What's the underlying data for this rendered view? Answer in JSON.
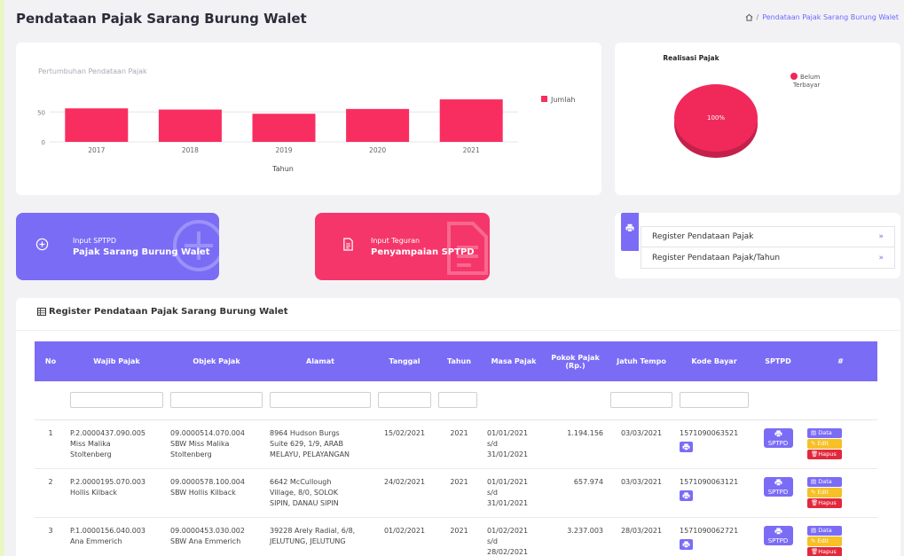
{
  "page": {
    "title": "Pendataan Pajak Sarang Burung Walet",
    "breadcrumb": [
      "Pendataan Pajak Sarang Burung Walet"
    ]
  },
  "bar_chart_card": {
    "chart_data": {
      "type": "bar",
      "title": "Pertumbuhan Pendataan Pajak",
      "xlabel": "Tahun",
      "categories": [
        "2017",
        "2018",
        "2019",
        "2020",
        "2021"
      ],
      "series": [
        {
          "name": "Jumlah",
          "values": [
            56,
            54,
            47,
            55,
            71
          ]
        }
      ],
      "yticks": [
        "50",
        "0"
      ],
      "ylim": [
        0,
        80
      ],
      "grid": true,
      "legend": "right",
      "color": "#f92e60"
    }
  },
  "pie_card": {
    "chart_data": {
      "type": "pie",
      "title": "Realisasi Pajak",
      "slices": [
        {
          "name": "Belum Terbayar",
          "value": 100,
          "label": "100%"
        }
      ],
      "legend": "top-right",
      "color": "#f0295a"
    },
    "legend_line1": "Belum",
    "legend_line2": "Terbayar"
  },
  "actions": {
    "sptpd": {
      "line1": "Input SPTPD",
      "line2": "Pajak Sarang Burung Walet",
      "color": "#7b6cf6"
    },
    "teguran": {
      "line1": "Input Teguran",
      "line2": "Penyampaian SPTPD",
      "color": "#f5366a"
    }
  },
  "register_links": {
    "items": [
      {
        "label": "Register Pendataan Pajak",
        "chevron": "»"
      },
      {
        "label": "Register Pendataan Pajak/Tahun",
        "chevron": "»"
      }
    ]
  },
  "table": {
    "title": "Register Pendataan Pajak Sarang Burung Walet",
    "headers": [
      "No",
      "Wajib Pajak",
      "Objek Pajak",
      "Alamat",
      "Tanggal",
      "Tahun",
      "Masa Pajak",
      "Pokok Pajak (Rp.)",
      "Jatuh Tempo",
      "Kode Bayar",
      "SPTPD",
      "#"
    ],
    "rows": [
      {
        "no": "1",
        "wajib_pajak": [
          "P.2.0000437.090.005",
          "Miss Malika",
          "Stoltenberg"
        ],
        "objek_pajak": [
          "09.0000514.070.004",
          "SBW Miss Malika",
          "Stoltenberg"
        ],
        "alamat": [
          "8964 Hudson Burgs",
          "Suite 629, 1/9, ARAB",
          "MELAYU, PELAYANGAN"
        ],
        "tanggal": "15/02/2021",
        "tahun": "2021",
        "masa_pajak": [
          "01/01/2021",
          "s/d",
          "31/01/2021"
        ],
        "pokok": "1.194.156",
        "jatuh_tempo": "03/03/2021",
        "kode_bayar": "1571090063521"
      },
      {
        "no": "2",
        "wajib_pajak": [
          "P.2.0000195.070.003",
          "Hollis Kilback"
        ],
        "objek_pajak": [
          "09.0000578.100.004",
          "SBW Hollis Kilback"
        ],
        "alamat": [
          "6642 McCullough",
          "Village, 8/0, SOLOK",
          "SIPIN, DANAU SIPIN"
        ],
        "tanggal": "24/02/2021",
        "tahun": "2021",
        "masa_pajak": [
          "01/01/2021",
          "s/d",
          "31/01/2021"
        ],
        "pokok": "657.974",
        "jatuh_tempo": "03/03/2021",
        "kode_bayar": "1571090063121"
      },
      {
        "no": "3",
        "wajib_pajak": [
          "P.1.0000156.040.003",
          "Ana Emmerich"
        ],
        "objek_pajak": [
          "09.0000453.030.002",
          "SBW Ana Emmerich"
        ],
        "alamat": [
          "39228 Arely Radial, 6/8,",
          "JELUTUNG, JELUTUNG"
        ],
        "tanggal": "01/02/2021",
        "tahun": "2021",
        "masa_pajak": [
          "01/02/2021",
          "s/d",
          "28/02/2021"
        ],
        "pokok": "3.237.003",
        "jatuh_tempo": "28/03/2021",
        "kode_bayar": "1571090062721"
      }
    ],
    "buttons": {
      "sptpd": "SPTPD",
      "data": "Data",
      "edit": "Edit",
      "hapus": "Hapus"
    }
  }
}
